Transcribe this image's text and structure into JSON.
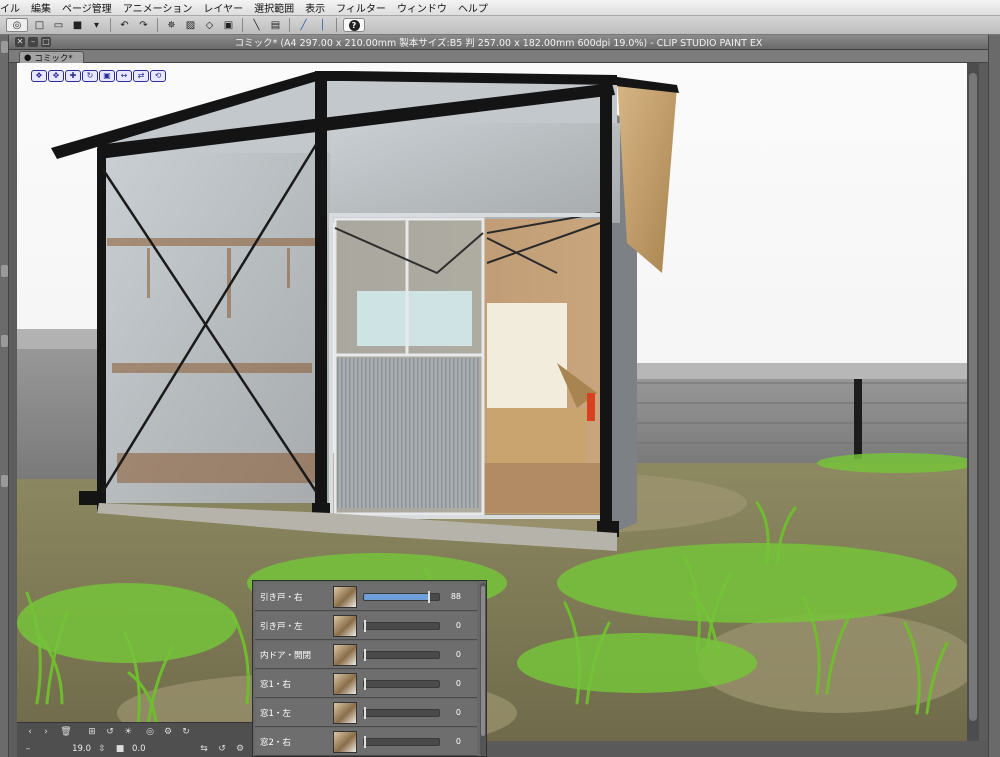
{
  "menu": [
    "イル",
    "編集",
    "ページ管理",
    "アニメーション",
    "レイヤー",
    "選択範囲",
    "表示",
    "フィルター",
    "ウィンドウ",
    "ヘルプ"
  ],
  "toolbar": {
    "icons": [
      "clip-studio-icon",
      "new-file-icon",
      "open-file-icon",
      "save-icon",
      "menu-icon",
      "undo-icon",
      "redo-icon",
      "transform-icon",
      "fill-icon",
      "clear-icon",
      "selection-icon",
      "deselect-icon",
      "ruler-icon",
      "snap-icon",
      "snap-ruler-icon",
      "help-icon"
    ],
    "help_label": "?"
  },
  "window": {
    "title": "コミック* (A4 297.00 x 210.00mm 製本サイズ:B5 判 257.00 x 182.00mm 600dpi 19.0%)  - CLIP STUDIO PAINT EX",
    "tab": "コミック*"
  },
  "canvas_nav_icons": [
    "camera-move-icon",
    "camera-pan-icon",
    "object-move-icon",
    "object-rotate-icon",
    "object-scale-icon",
    "object-pan-icon",
    "object-flip-icon",
    "reset-icon"
  ],
  "status": {
    "zoom": "19.0",
    "angle": "0.0"
  },
  "object_panel": {
    "rows": [
      {
        "label": "引き戸・右",
        "value": 88
      },
      {
        "label": "引き戸・左",
        "value": 0
      },
      {
        "label": "内ドア・開閉",
        "value": 0
      },
      {
        "label": "窓1・右",
        "value": 0
      },
      {
        "label": "窓1・左",
        "value": 0
      },
      {
        "label": "窓2・右",
        "value": 0
      }
    ]
  },
  "colors": {
    "slider_fill": "#6f9fd8",
    "sky": "#f7f7f7",
    "grass": "#6fbd2e"
  }
}
